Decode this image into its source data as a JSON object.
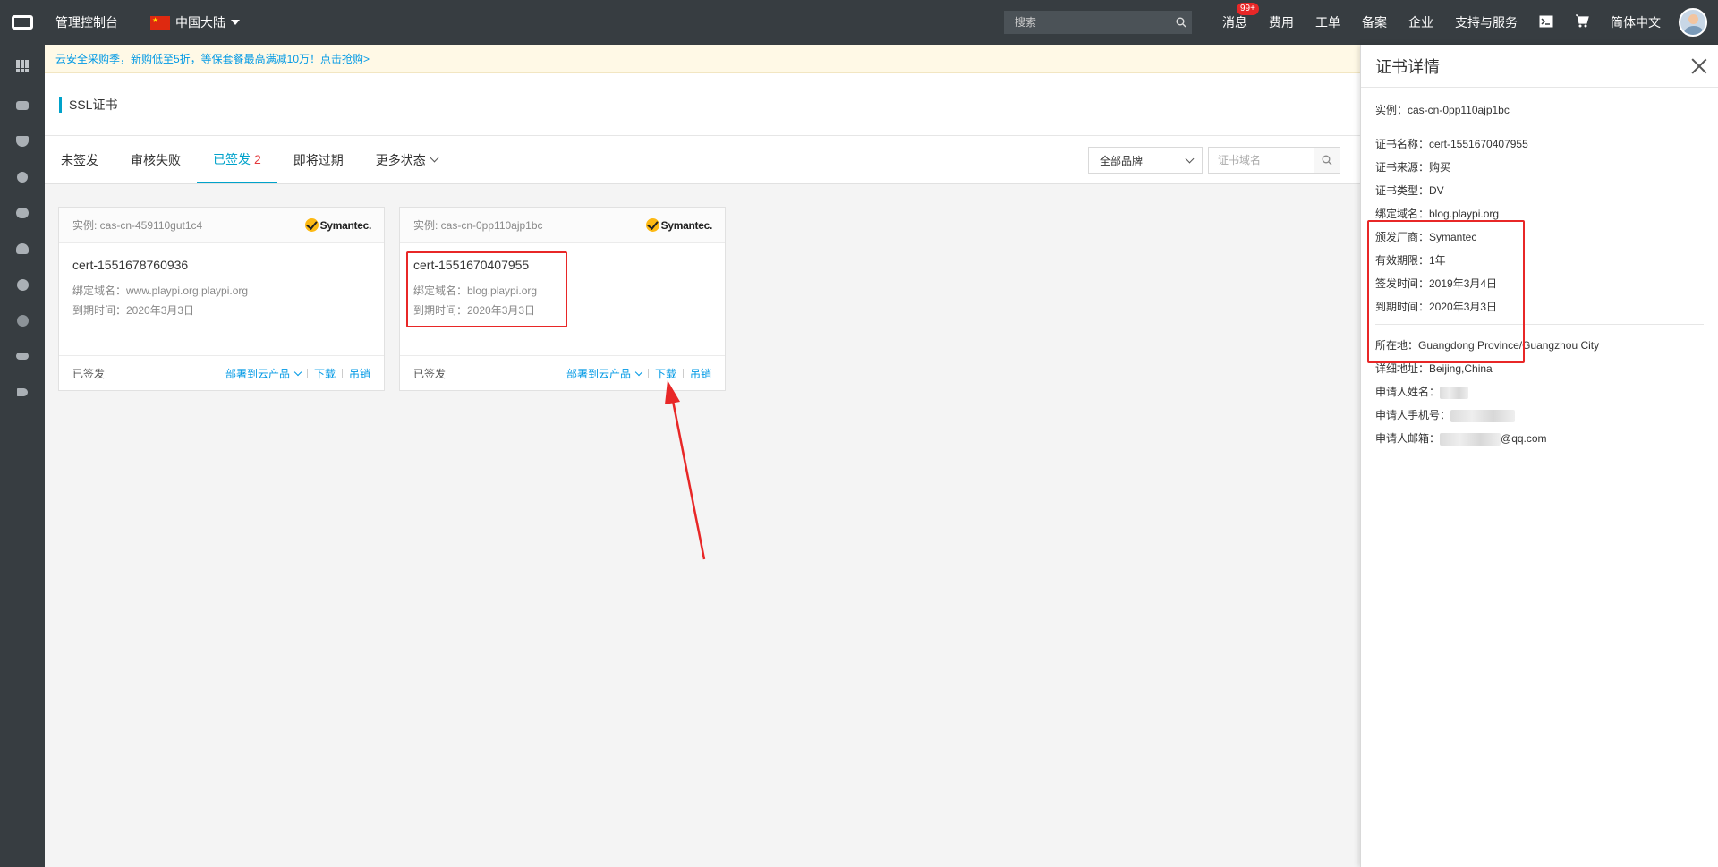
{
  "topbar": {
    "console": "管理控制台",
    "region": "中国大陆",
    "search_placeholder": "搜索",
    "nav": {
      "messages": "消息",
      "messages_badge": "99+",
      "billing": "费用",
      "tickets": "工单",
      "icp": "备案",
      "enterprise": "企业",
      "support": "支持与服务",
      "language": "简体中文"
    }
  },
  "notice": "云安全采购季，新购低至5折，等保套餐最高满减10万！点击抢购>",
  "page": {
    "title": "SSL证书"
  },
  "tabs": [
    {
      "label": "未签发",
      "count": ""
    },
    {
      "label": "审核失败",
      "count": ""
    },
    {
      "label": "已签发",
      "count": "2"
    },
    {
      "label": "即将过期",
      "count": ""
    },
    {
      "label": "更多状态",
      "count": ""
    }
  ],
  "filters": {
    "brand": "全部品牌",
    "domain_placeholder": "证书域名"
  },
  "cards": [
    {
      "instance": "实例: cas-cn-459110gut1c4",
      "brand": "Symantec.",
      "name": "cert-1551678760936",
      "domain": "绑定域名：www.playpi.org,playpi.org",
      "expire": "到期时间：2020年3月3日",
      "status": "已签发",
      "deploy": "部署到云产品",
      "download": "下载",
      "revoke": "吊销"
    },
    {
      "instance": "实例: cas-cn-0pp110ajp1bc",
      "brand": "Symantec.",
      "name": "cert-1551670407955",
      "domain": "绑定域名：blog.playpi.org",
      "expire": "到期时间：2020年3月3日",
      "status": "已签发",
      "deploy": "部署到云产品",
      "download": "下载",
      "revoke": "吊销"
    }
  ],
  "panel": {
    "title": "证书详情",
    "instance": "实例：cas-cn-0pp110ajp1bc",
    "name": "证书名称：cert-1551670407955",
    "source": "证书来源：购买",
    "type": "证书类型：DV",
    "domain": "绑定域名：blog.playpi.org",
    "issuer": "颁发厂商：Symantec",
    "validity": "有效期限：1年",
    "issued": "签发时间：2019年3月4日",
    "expires": "到期时间：2020年3月3日",
    "location": "所在地：Guangdong Province/Guangzhou City",
    "address": "详细地址：Beijing,China",
    "applicant_name_label": "申请人姓名：",
    "applicant_phone_label": "申请人手机号：",
    "applicant_email_label": "申请人邮箱：",
    "applicant_email_suffix": "@qq.com"
  },
  "colors": {
    "topbar": "#373d41",
    "accent": "#00a2ca",
    "link": "#0099e5",
    "highlight": "#e82727"
  }
}
